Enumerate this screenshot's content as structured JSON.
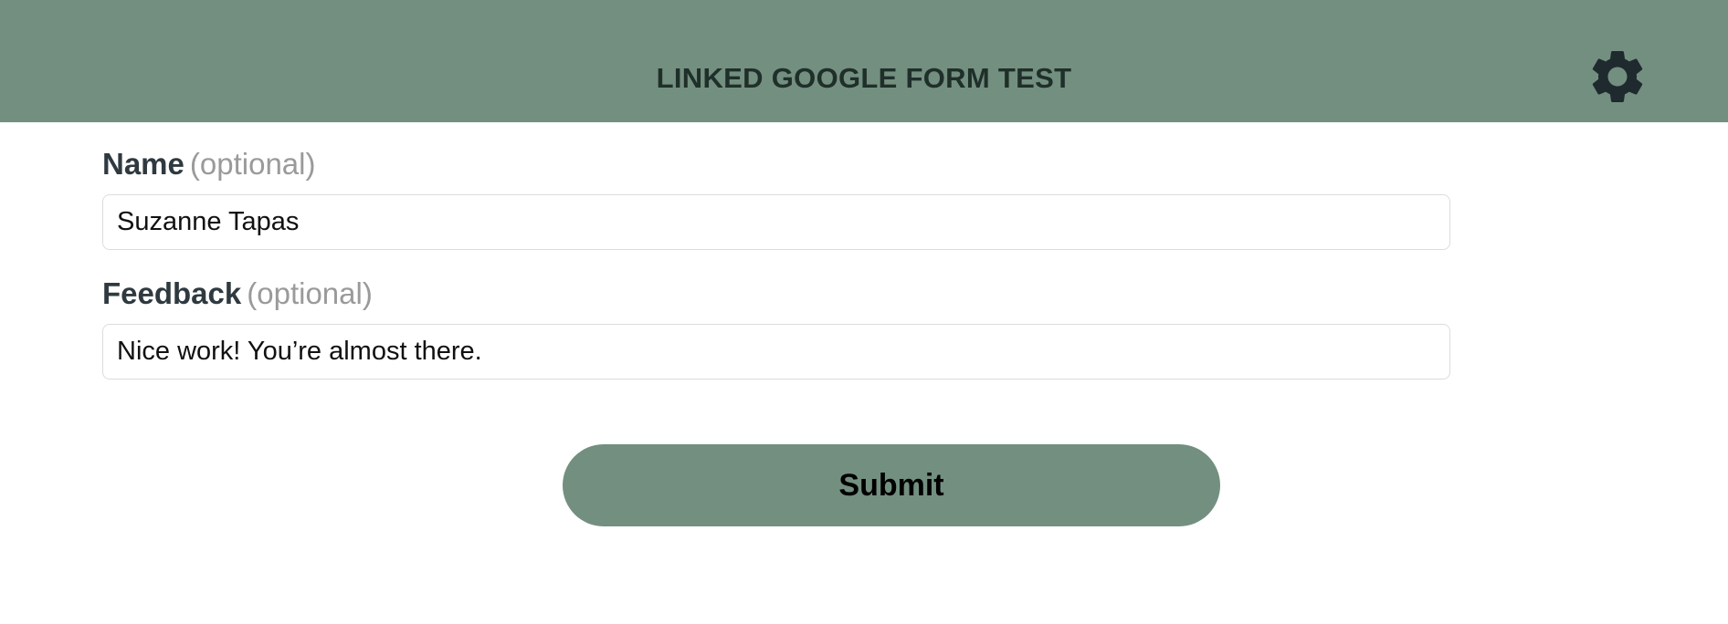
{
  "header": {
    "title": "LINKED GOOGLE FORM TEST",
    "settings_icon": "gear-icon"
  },
  "form": {
    "fields": [
      {
        "label": "Name",
        "hint": "(optional)",
        "value": "Suzanne Tapas"
      },
      {
        "label": "Feedback",
        "hint": "(optional)",
        "value": "Nice work! You’re almost there."
      }
    ],
    "submit_label": "Submit"
  },
  "colors": {
    "accent": "#738f80",
    "header_text": "#1f2f2a",
    "label_text": "#2f3a40",
    "hint_text": "#9a9a9a",
    "input_border": "#dcdcdc"
  }
}
